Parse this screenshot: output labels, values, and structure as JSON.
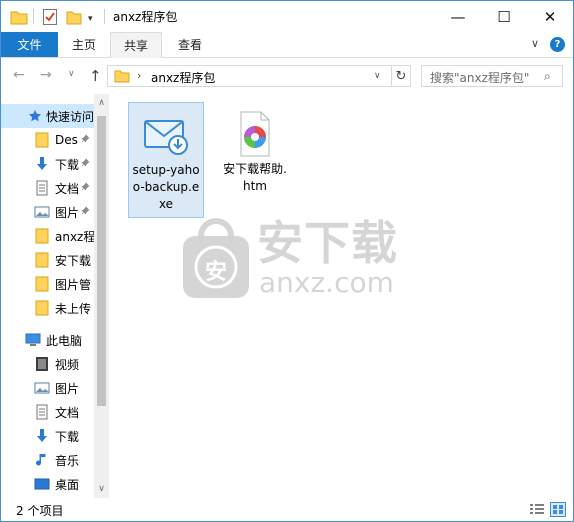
{
  "window": {
    "title": "anxz程序包",
    "minimize_glyph": "—",
    "maximize_glyph": "☐",
    "close_glyph": "✕"
  },
  "quick_access_toolbar": {
    "icons": [
      "folder-icon",
      "properties-check-icon",
      "new-folder-icon",
      "customize-dropdown-icon"
    ],
    "dropdown_glyph": "▾"
  },
  "ribbon": {
    "tabs": [
      {
        "label": "文件",
        "active": true
      },
      {
        "label": "主页"
      },
      {
        "label": "共享"
      },
      {
        "label": "查看"
      }
    ],
    "expand_glyph": "∨",
    "help_glyph": "?"
  },
  "address_bar": {
    "back_glyph": "←",
    "forward_glyph": "→",
    "recent_glyph": "∨",
    "up_glyph": "↑",
    "separator_glyph": "›",
    "path": "anxz程序包",
    "dropdown_glyph": "∨",
    "refresh_glyph": "↻"
  },
  "search": {
    "placeholder": "搜索\"anxz程序包\"",
    "icon_glyph": "⌕"
  },
  "nav_pane": {
    "items": [
      {
        "label": "快速访问",
        "icon": "star-icon",
        "selected": true
      },
      {
        "label": "Des",
        "icon": "folder-icon",
        "pinned": true
      },
      {
        "label": "下载",
        "icon": "download-arrow-icon",
        "pinned": true
      },
      {
        "label": "文档",
        "icon": "document-icon",
        "pinned": true
      },
      {
        "label": "图片",
        "icon": "picture-icon",
        "pinned": true
      },
      {
        "label": "anxz程",
        "icon": "folder-icon"
      },
      {
        "label": "安下载",
        "icon": "folder-icon"
      },
      {
        "label": "图片管",
        "icon": "folder-icon"
      },
      {
        "label": "未上传",
        "icon": "folder-icon"
      },
      {
        "label": "此电脑",
        "icon": "computer-icon"
      },
      {
        "label": "视频",
        "icon": "video-icon"
      },
      {
        "label": "图片",
        "icon": "picture-icon"
      },
      {
        "label": "文档",
        "icon": "document-icon"
      },
      {
        "label": "下载",
        "icon": "download-arrow-icon"
      },
      {
        "label": "音乐",
        "icon": "music-note-icon"
      },
      {
        "label": "桌面",
        "icon": "desktop-icon"
      }
    ],
    "pin_glyph": "📌",
    "scroll_up_glyph": "∧",
    "scroll_down_glyph": "∨"
  },
  "files": [
    {
      "name": "setup-yahoo-backup.exe",
      "icon": "envelope-download-icon",
      "selected": true
    },
    {
      "name": "安下载帮助.htm",
      "icon": "html-document-icon",
      "selected": false
    }
  ],
  "watermark": {
    "title": "安下载",
    "subtitle": "anxz.com",
    "badge": "安"
  },
  "status_bar": {
    "item_count": "2 个项目"
  },
  "colors": {
    "accent": "#1979ca",
    "selection": "#cce8ff",
    "folder": "#ffd25a"
  }
}
